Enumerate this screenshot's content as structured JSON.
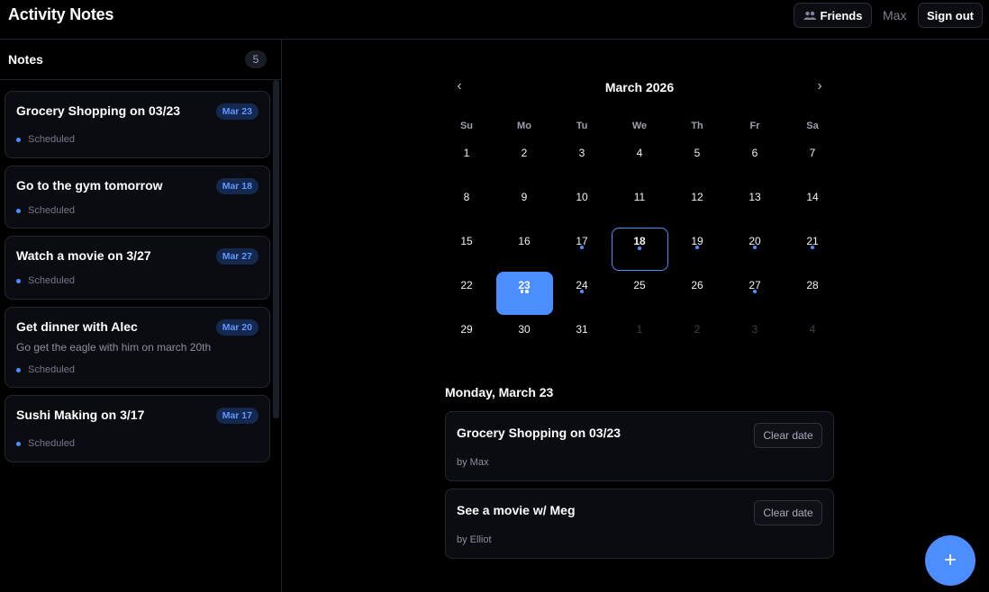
{
  "header": {
    "title": "Activity Notes",
    "friends_label": "Friends",
    "user_name": "Max",
    "signout_label": "Sign out"
  },
  "sidebar": {
    "title": "Notes",
    "count": "5",
    "notes": [
      {
        "title": "Grocery Shopping on 03/23",
        "badge": "Mar 23",
        "description": "",
        "status": "Scheduled"
      },
      {
        "title": "Go to the gym tomorrow",
        "badge": "Mar 18",
        "description": "",
        "status": "Scheduled"
      },
      {
        "title": "Watch a movie on 3/27",
        "badge": "Mar 27",
        "description": "",
        "status": "Scheduled"
      },
      {
        "title": "Get dinner with Alec",
        "badge": "Mar 20",
        "description": "Go get the eagle with him on march 20th",
        "status": "Scheduled"
      },
      {
        "title": "Sushi Making on 3/17",
        "badge": "Mar 17",
        "description": "",
        "status": "Scheduled"
      }
    ]
  },
  "calendar": {
    "month_label": "March 2026",
    "prev_label": "‹",
    "next_label": "›",
    "weekdays": [
      "Su",
      "Mo",
      "Tu",
      "We",
      "Th",
      "Fr",
      "Sa"
    ],
    "days": [
      {
        "label": "1",
        "other": false,
        "dots": 0
      },
      {
        "label": "2",
        "other": false,
        "dots": 0
      },
      {
        "label": "3",
        "other": false,
        "dots": 0
      },
      {
        "label": "4",
        "other": false,
        "dots": 0
      },
      {
        "label": "5",
        "other": false,
        "dots": 0
      },
      {
        "label": "6",
        "other": false,
        "dots": 0
      },
      {
        "label": "7",
        "other": false,
        "dots": 0
      },
      {
        "label": "8",
        "other": false,
        "dots": 0
      },
      {
        "label": "9",
        "other": false,
        "dots": 0
      },
      {
        "label": "10",
        "other": false,
        "dots": 0
      },
      {
        "label": "11",
        "other": false,
        "dots": 0
      },
      {
        "label": "12",
        "other": false,
        "dots": 0
      },
      {
        "label": "13",
        "other": false,
        "dots": 0
      },
      {
        "label": "14",
        "other": false,
        "dots": 0
      },
      {
        "label": "15",
        "other": false,
        "dots": 0
      },
      {
        "label": "16",
        "other": false,
        "dots": 0
      },
      {
        "label": "17",
        "other": false,
        "dots": 1
      },
      {
        "label": "18",
        "other": false,
        "dots": 1,
        "today": true
      },
      {
        "label": "19",
        "other": false,
        "dots": 1
      },
      {
        "label": "20",
        "other": false,
        "dots": 1
      },
      {
        "label": "21",
        "other": false,
        "dots": 1
      },
      {
        "label": "22",
        "other": false,
        "dots": 0
      },
      {
        "label": "23",
        "other": false,
        "dots": 2,
        "selected": true
      },
      {
        "label": "24",
        "other": false,
        "dots": 1
      },
      {
        "label": "25",
        "other": false,
        "dots": 0
      },
      {
        "label": "26",
        "other": false,
        "dots": 0
      },
      {
        "label": "27",
        "other": false,
        "dots": 1
      },
      {
        "label": "28",
        "other": false,
        "dots": 0
      },
      {
        "label": "29",
        "other": false,
        "dots": 0
      },
      {
        "label": "30",
        "other": false,
        "dots": 0
      },
      {
        "label": "31",
        "other": false,
        "dots": 0
      },
      {
        "label": "1",
        "other": true,
        "dots": 0
      },
      {
        "label": "2",
        "other": true,
        "dots": 0
      },
      {
        "label": "3",
        "other": true,
        "dots": 0
      },
      {
        "label": "4",
        "other": true,
        "dots": 0
      }
    ]
  },
  "detail": {
    "date_label": "Monday, March 23",
    "events": [
      {
        "title": "Grocery Shopping on 03/23",
        "by": "by Max",
        "clear_label": "Clear date"
      },
      {
        "title": "See a movie w/ Meg",
        "by": "by Elliot",
        "clear_label": "Clear date"
      }
    ]
  },
  "fab_label": "+",
  "colors": {
    "accent": "#4c8dff",
    "badge_bg": "#15284f",
    "background": "#000000",
    "card_bg": "#0a0c11"
  }
}
